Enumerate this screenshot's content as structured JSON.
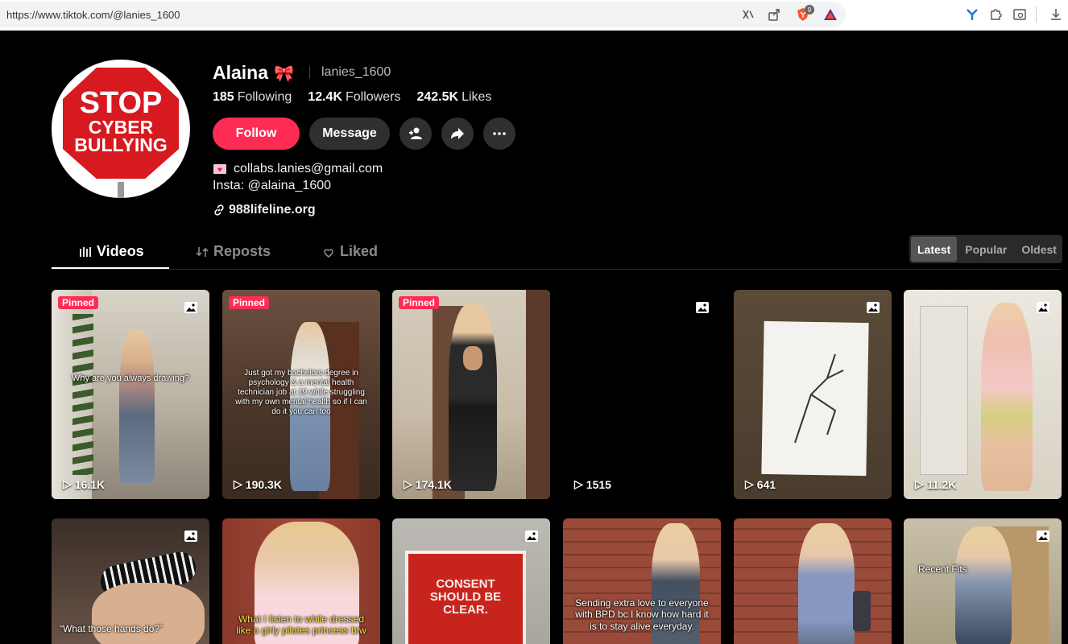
{
  "browser": {
    "url": "https://www.tiktok.com/@lanies_1600",
    "brave_badge": "9"
  },
  "profile": {
    "display_name": "Alaina",
    "username": "lanies_1600",
    "avatar_text": [
      "STOP",
      "CYBER",
      "BULLYING"
    ],
    "stats": {
      "following_count": "185",
      "following_label": "Following",
      "followers_count": "12.4K",
      "followers_label": "Followers",
      "likes_count": "242.5K",
      "likes_label": "Likes"
    },
    "buttons": {
      "follow": "Follow",
      "message": "Message"
    },
    "bio": {
      "email": "collabs.lanies@gmail.com",
      "insta": "Insta: @alaina_1600",
      "link": "988lifeline.org"
    }
  },
  "tabs": [
    {
      "label": "Videos"
    },
    {
      "label": "Reposts"
    },
    {
      "label": "Liked"
    }
  ],
  "sort": {
    "options": [
      "Latest",
      "Popular",
      "Oldest"
    ],
    "selected": "Latest"
  },
  "pinned_label": "Pinned",
  "videos_row1": [
    {
      "views": "16.1K",
      "pinned": true,
      "caption": "Why are you always drawing?"
    },
    {
      "views": "190.3K",
      "pinned": true,
      "caption": "Just got my bachelors degree in psychology & a mental health technician job at 19 while struggling with my own mental health so if I can do it you can too"
    },
    {
      "views": "174.1K",
      "pinned": true,
      "caption": ""
    },
    {
      "views": "1515",
      "pinned": false,
      "caption": ""
    },
    {
      "views": "641",
      "pinned": false,
      "caption": ""
    },
    {
      "views": "11.2K",
      "pinned": false,
      "caption": ""
    }
  ],
  "videos_row2": [
    {
      "caption": "“What those hands do?”"
    },
    {
      "caption": "What I listen to while dressed like a girly pilates princess btw"
    },
    {
      "caption": "CONSENT SHOULD BE CLEAR."
    },
    {
      "caption": "Sending extra love to everyone with BPD bc I know how hard it is to stay alive everyday."
    },
    {
      "caption": ""
    },
    {
      "caption": "Recent Fits"
    }
  ],
  "colors": {
    "accent": "#fe2c55",
    "background": "#000000",
    "button_dark": "#2f2f2f"
  }
}
